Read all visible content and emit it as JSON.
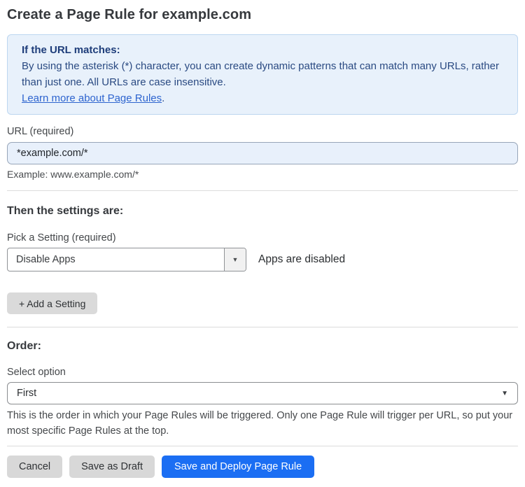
{
  "page": {
    "title": "Create a Page Rule for example.com"
  },
  "info_box": {
    "heading": "If the URL matches:",
    "body": "By using the asterisk (*) character, you can create dynamic patterns that can match many URLs, rather than just one. All URLs are case insensitive.",
    "link_label": "Learn more about Page Rules",
    "link_suffix": "."
  },
  "url_field": {
    "label": "URL (required)",
    "value": "*example.com/*",
    "helper": "Example: www.example.com/*"
  },
  "settings_section": {
    "heading": "Then the settings are:",
    "picker_label": "Pick a Setting (required)",
    "picker_value": "Disable Apps",
    "status_text": "Apps are disabled",
    "add_button_label": "+ Add a Setting"
  },
  "order_section": {
    "heading": "Order:",
    "select_label": "Select option",
    "select_value": "First",
    "helper": "This is the order in which your Page Rules will be triggered. Only one Page Rule will trigger per URL, so put your most specific Page Rules at the top."
  },
  "footer": {
    "cancel_label": "Cancel",
    "save_draft_label": "Save as Draft",
    "save_deploy_label": "Save and Deploy Page Rule"
  },
  "icons": {
    "caret_down": "▼"
  },
  "colors": {
    "accent_blue": "#1b6ef3",
    "info_box_bg": "#e8f1fb",
    "info_box_border": "#bcd6f0",
    "info_text": "#2a4a82",
    "link_blue": "#2d64cf",
    "input_bg": "#e8f0fb",
    "button_gray": "#d8d8d8"
  }
}
